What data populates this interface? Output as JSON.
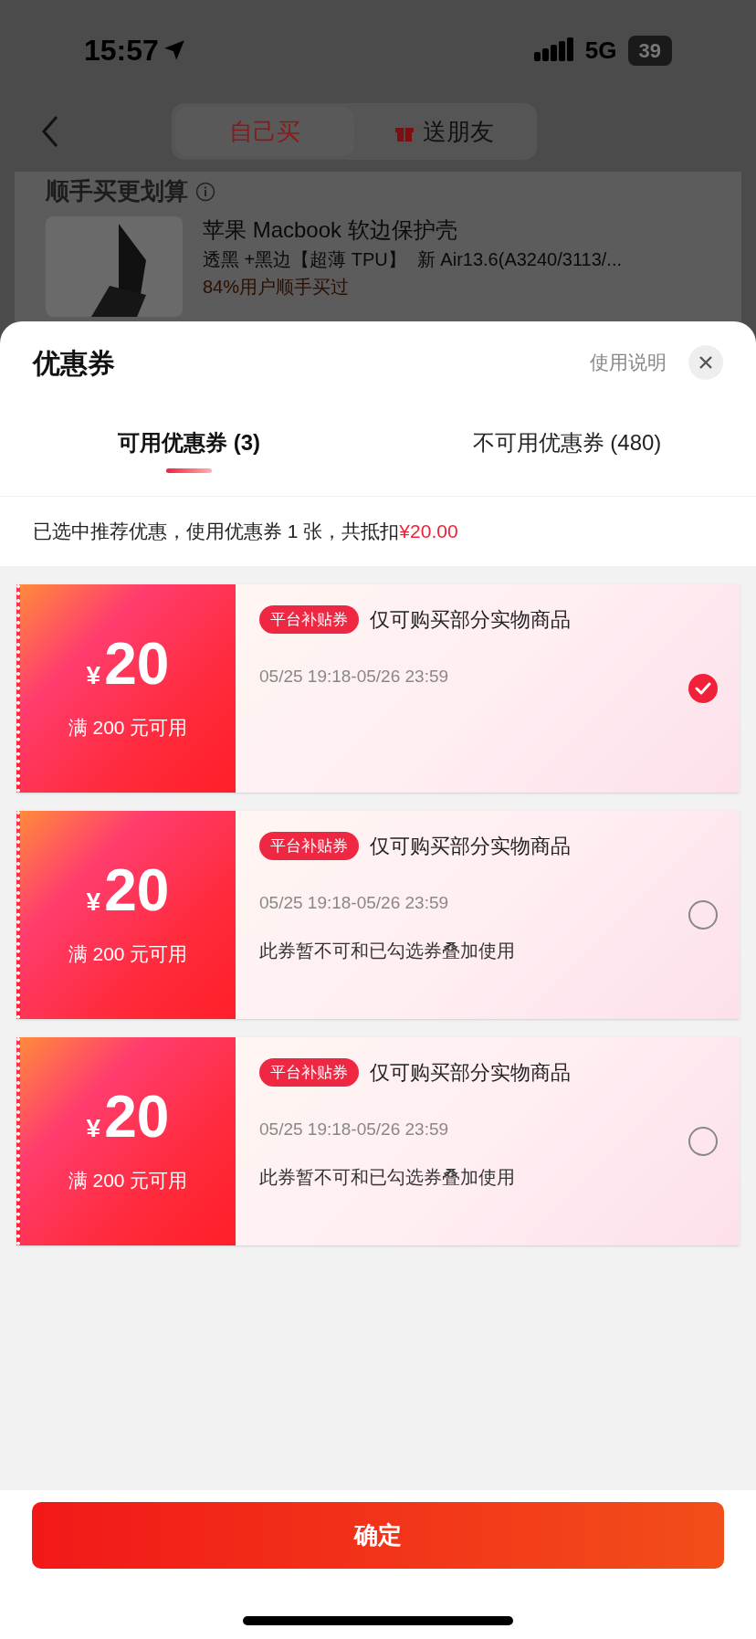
{
  "status_bar": {
    "time": "15:57",
    "network": "5G",
    "battery": "39"
  },
  "nav": {
    "segments": [
      {
        "label": "自己买",
        "selected": true
      },
      {
        "label": "送朋友",
        "selected": false
      }
    ]
  },
  "background_page": {
    "section_title": "顺手买更划算",
    "product": {
      "kind": "picture",
      "name": "苹果 Macbook 软边保护壳",
      "variant": "透黑 +黑边【超薄 TPU】",
      "model": "新 Air13.6(A3240/3113/...",
      "stat": "84%用户顺手买过"
    }
  },
  "sheet": {
    "title": "优惠券",
    "help_link": "使用说明",
    "tabs": [
      {
        "label": "可用优惠券 (3)",
        "selected": true
      },
      {
        "label": "不可用优惠券 (480)",
        "selected": false
      }
    ],
    "summary": {
      "text": "已选中推荐优惠，使用优惠券 1 张，共抵扣",
      "amount": "¥20.00"
    },
    "coupons": [
      {
        "currency": "¥",
        "amount": "20",
        "condition": "满 200 元可用",
        "tag": "平台补贴券",
        "title": "仅可购买部分实物商品",
        "validity": "05/25 19:18-05/26 23:59",
        "selected": true
      },
      {
        "currency": "¥",
        "amount": "20",
        "condition": "满 200 元可用",
        "tag": "平台补贴券",
        "title": "仅可购买部分实物商品",
        "validity": "05/25 19:18-05/26 23:59",
        "note": "此券暂不可和已勾选券叠加使用",
        "selected": false
      },
      {
        "currency": "¥",
        "amount": "20",
        "condition": "满 200 元可用",
        "tag": "平台补贴券",
        "title": "仅可购买部分实物商品",
        "validity": "05/25 19:18-05/26 23:59",
        "note": "此券暂不可和已勾选券叠加使用",
        "selected": false
      }
    ],
    "confirm_button": "确定"
  }
}
